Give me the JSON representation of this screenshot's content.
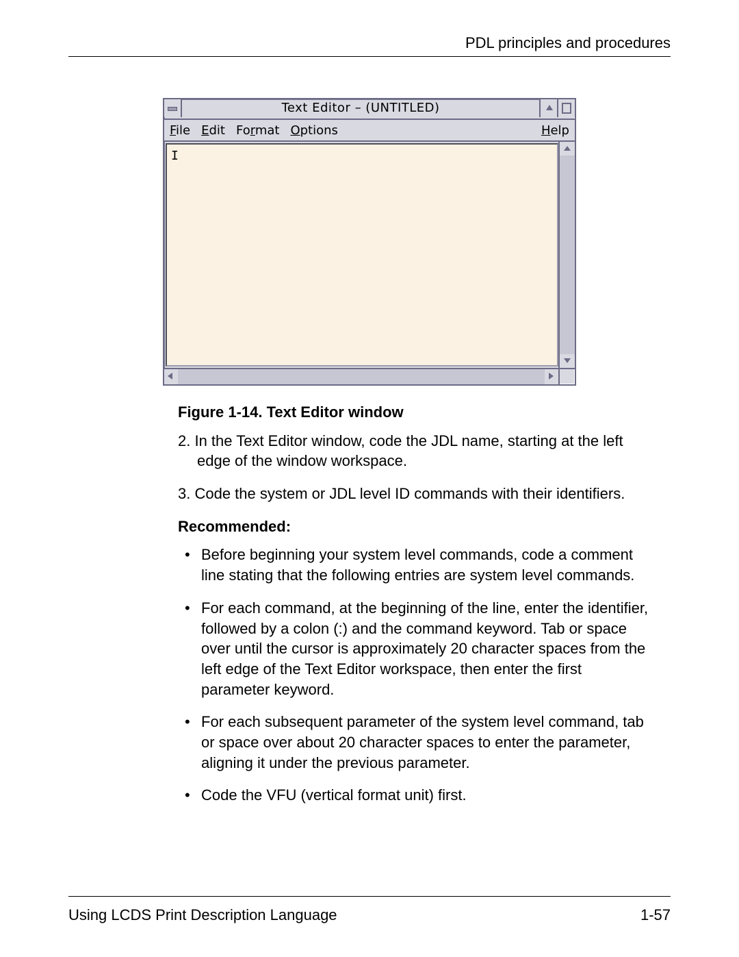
{
  "header": {
    "title": "PDL principles and procedures"
  },
  "footer": {
    "left": "Using LCDS Print Description Language",
    "right": "1-57"
  },
  "editor": {
    "title": "Text Editor – (UNTITLED)",
    "menu": {
      "file": {
        "pre": "",
        "ul": "F",
        "post": "ile"
      },
      "edit": {
        "pre": "",
        "ul": "E",
        "post": "dit"
      },
      "format": {
        "pre": "Fo",
        "ul": "r",
        "post": "mat"
      },
      "options": {
        "pre": "",
        "ul": "O",
        "post": "ptions"
      },
      "help": {
        "pre": "",
        "ul": "H",
        "post": "elp"
      }
    },
    "cursor": "I"
  },
  "figure": {
    "caption": "Figure 1-14. Text Editor window"
  },
  "paras": {
    "p2": "2. In the Text Editor window, code the JDL name, starting at the left edge of the window workspace.",
    "p3": "3. Code the system or JDL level ID commands with their identifiers."
  },
  "recommended": {
    "heading": "Recommended:",
    "bullets": [
      "Before beginning your system level commands, code a comment line stating that the following entries are system level commands.",
      "For each command, at the beginning of the line, enter the identifier, followed by a colon (:) and the command keyword. Tab or space over until the cursor is approximately 20 character spaces from the left edge of the Text Editor workspace, then enter the first parameter keyword.",
      "For each subsequent parameter of the system level command, tab or space over about 20 character spaces to enter the parameter, aligning it under the previous parameter.",
      "Code the VFU (vertical format unit) first."
    ]
  }
}
